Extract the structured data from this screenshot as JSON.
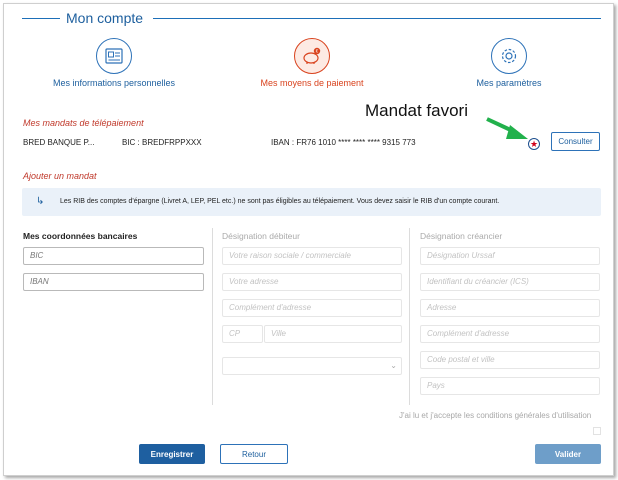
{
  "header": {
    "title": "Mon compte"
  },
  "nav": [
    {
      "label": "Mes informations personnelles",
      "icon": "id-card-icon",
      "active": false
    },
    {
      "label": "Mes moyens de paiement",
      "icon": "piggy-bank-icon",
      "active": true
    },
    {
      "label": "Mes paramètres",
      "icon": "gear-icon",
      "active": false
    }
  ],
  "mandates": {
    "title": "Mes mandats de télépaiement",
    "row": {
      "bank": "BRED BANQUE P...",
      "bic": "BIC : BREDFRPPXXX",
      "iban": "IBAN : FR76 1010 **** **** **** 9315 773",
      "favorite_icon": "star-icon",
      "consult_label": "Consulter"
    }
  },
  "annotation": {
    "text": "Mandat favori"
  },
  "add_mandate": {
    "title": "Ajouter un mandat",
    "info": "Les RIB des comptes d'épargne (Livret A, LEP, PEL etc.) ne sont pas éligibles au télépaiement. Vous devez saisir le RIB d'un compte courant."
  },
  "bank_details": {
    "title": "Mes coordonnées bancaires",
    "bic_placeholder": "BIC",
    "iban_placeholder": "IBAN"
  },
  "debtor": {
    "title": "Désignation débiteur",
    "company_placeholder": "Votre raison sociale / commerciale",
    "address_placeholder": "Votre adresse",
    "address2_placeholder": "Complément d'adresse",
    "zip_placeholder": "CP",
    "city_placeholder": "Ville",
    "country_value": ""
  },
  "creditor": {
    "title": "Désignation créancier",
    "name_placeholder": "Désignation Urssaf",
    "ics_placeholder": "Identifiant du créancier (ICS)",
    "address_placeholder": "Adresse",
    "address2_placeholder": "Complément d'adresse",
    "zip_city_placeholder": "Code postal et ville",
    "country_placeholder": "Pays"
  },
  "terms": {
    "text": "J'ai lu et j'accepte les conditions générales d'utilisation"
  },
  "actions": {
    "save_label": "Enregistrer",
    "back_label": "Retour",
    "validate_label": "Valider"
  },
  "colors": {
    "primary": "#1e5fa0",
    "accent": "#d9431e",
    "info_bg": "#eaf1f9",
    "annotation_arrow": "#22b14c"
  }
}
